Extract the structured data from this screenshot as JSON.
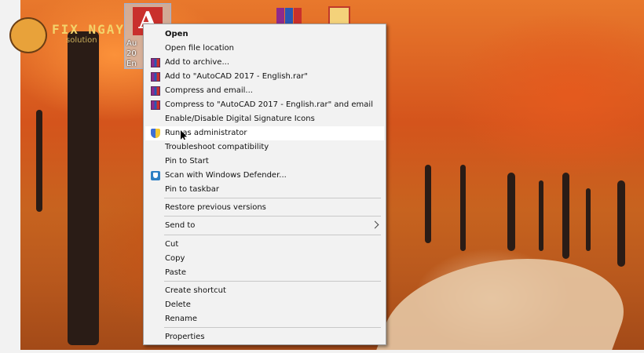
{
  "desktop": {
    "autocad_label": "Au\n20\nEn",
    "watermark_title": "FIX NGAY",
    "watermark_sub": "solution"
  },
  "context_menu": {
    "items": [
      {
        "label": "Open",
        "icon": "none",
        "bold": true
      },
      {
        "label": "Open file location",
        "icon": "none"
      },
      {
        "label": "Add to archive...",
        "icon": "winrar-icon"
      },
      {
        "label": "Add to \"AutoCAD 2017 - English.rar\"",
        "icon": "winrar-icon"
      },
      {
        "label": "Compress and email...",
        "icon": "winrar-icon"
      },
      {
        "label": "Compress to \"AutoCAD 2017 - English.rar\" and email",
        "icon": "winrar-icon"
      },
      {
        "label": "Enable/Disable Digital Signature Icons",
        "icon": "none"
      },
      {
        "label": "Run as administrator",
        "icon": "uac-shield-icon",
        "highlighted": true
      },
      {
        "label": "Troubleshoot compatibility",
        "icon": "none"
      },
      {
        "label": "Pin to Start",
        "icon": "none"
      },
      {
        "label": "Scan with Windows Defender...",
        "icon": "windows-defender-icon"
      },
      {
        "label": "Pin to taskbar",
        "icon": "none"
      },
      {
        "label": "Restore previous versions",
        "icon": "none"
      },
      {
        "label": "Send to",
        "icon": "none",
        "submenu": true
      },
      {
        "label": "Cut",
        "icon": "none"
      },
      {
        "label": "Copy",
        "icon": "none"
      },
      {
        "label": "Paste",
        "icon": "none"
      },
      {
        "label": "Create shortcut",
        "icon": "none"
      },
      {
        "label": "Delete",
        "icon": "none"
      },
      {
        "label": "Rename",
        "icon": "none"
      },
      {
        "label": "Properties",
        "icon": "none"
      }
    ]
  }
}
